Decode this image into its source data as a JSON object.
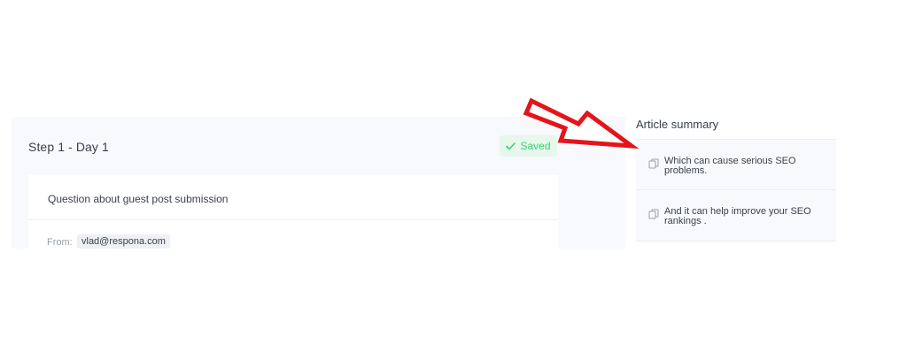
{
  "step": {
    "title": "Step 1 - Day 1",
    "status_label": "Saved",
    "status_color": "#3ecf6e",
    "status_icon": "check-icon"
  },
  "email": {
    "subject": "Question about guest post submission",
    "from_label": "From:",
    "from_value": "vlad@respona.com"
  },
  "summary": {
    "title": "Article summary",
    "items": [
      {
        "icon": "copy-icon",
        "text": "Which can cause serious SEO problems."
      },
      {
        "icon": "copy-icon",
        "text": "And it can help improve your SEO rankings ."
      }
    ]
  },
  "annotation": {
    "arrow_color": "#e3141b",
    "arrow_icon": "red-arrow-icon"
  }
}
